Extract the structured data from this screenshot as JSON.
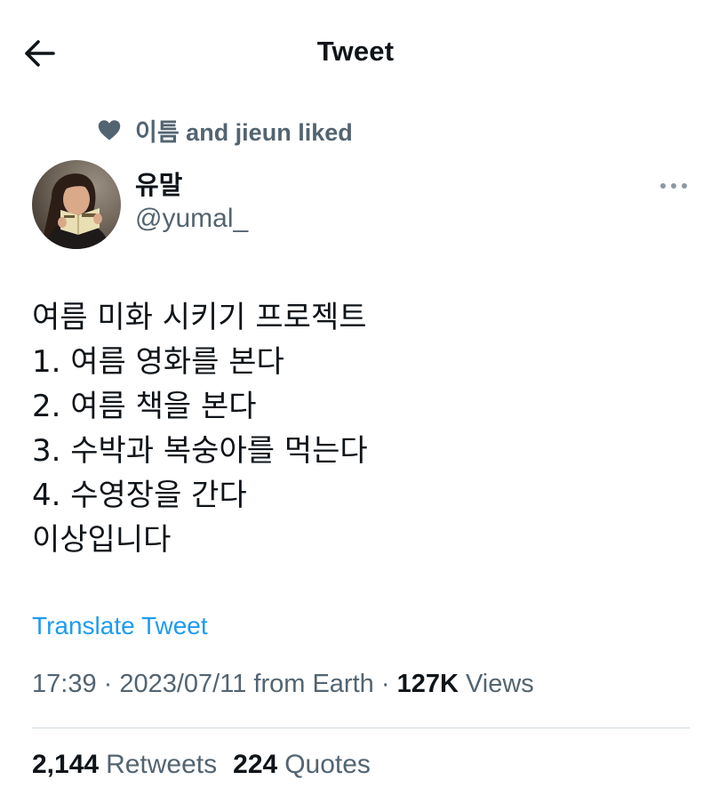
{
  "header": {
    "title": "Tweet"
  },
  "social_context": {
    "text": "이틈 and jieun liked",
    "icon": "heart-icon"
  },
  "author": {
    "name": "유말",
    "handle": "@yumal_"
  },
  "tweet": {
    "lines": [
      "여름 미화 시키기 프로젝트",
      "1. 여름 영화를 본다",
      "2. 여름 책을 본다",
      "3. 수박과 복숭아를 먹는다",
      "4. 수영장을 간다",
      "이상입니다"
    ]
  },
  "translate_label": "Translate Tweet",
  "meta": {
    "time": "17:39",
    "separator": " · ",
    "date_source": "2023/07/11 from Earth",
    "views_count": "127K",
    "views_label": "Views"
  },
  "stats": {
    "retweets_count": "2,144",
    "retweets_label": "Retweets",
    "quotes_count": "224",
    "quotes_label": "Quotes"
  },
  "colors": {
    "text_primary": "#0f1419",
    "text_secondary": "#536471",
    "accent": "#1d9bf0",
    "divider": "#cfd9de"
  }
}
